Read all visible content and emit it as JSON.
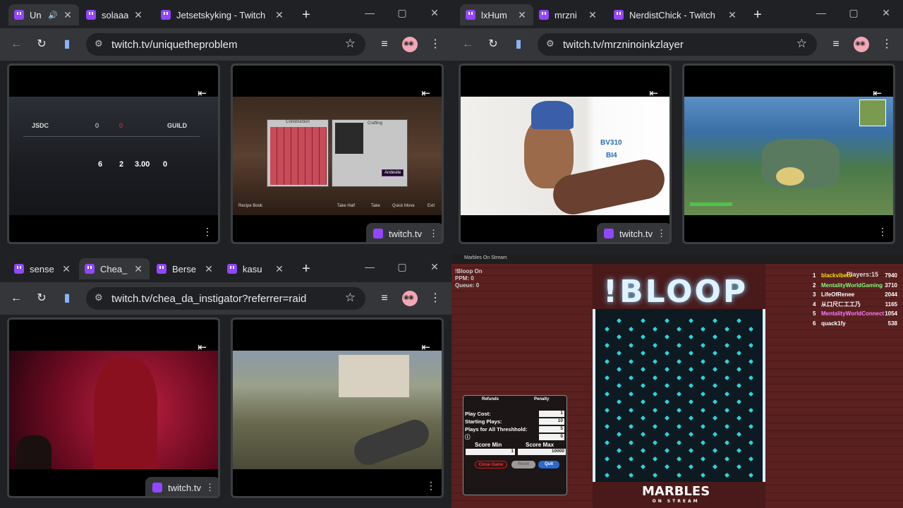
{
  "windows": [
    {
      "tabs": [
        {
          "title": "Un",
          "audio": true,
          "active": true
        },
        {
          "title": "solaaa",
          "active": false
        },
        {
          "title": "Jetsetskyking - Twitch",
          "active": false
        }
      ],
      "url": "twitch.tv/uniquetheproblem",
      "chip_label": "twitch.tv",
      "game1": {
        "team_left": "JSDC",
        "team_right": "GUILD",
        "score_left": "0",
        "score_right": "0",
        "stats": [
          "6",
          "2",
          "3.00",
          "0"
        ]
      },
      "game2": {
        "panel_left": "Construction",
        "panel_right": "Crafting",
        "tooltip": "Andesite",
        "bottom": [
          "Recipe Book",
          "Take Half",
          "Take",
          "Quick Move",
          "Exit"
        ],
        "counter": "88"
      }
    },
    {
      "tabs": [
        {
          "title": "lxHum",
          "active": true
        },
        {
          "title": "mrzni",
          "active": false
        },
        {
          "title": "NerdistChick - Twitch",
          "active": false
        }
      ],
      "url": "twitch.tv/mrzninoinkzlayer",
      "chip_label": "twitch.tv",
      "art_labels": [
        "BV310",
        "BI4"
      ]
    },
    {
      "tabs": [
        {
          "title": "sense",
          "active": false
        },
        {
          "title": "Chea_",
          "active": true
        },
        {
          "title": "Berse",
          "active": false
        },
        {
          "title": "kasu",
          "active": false
        }
      ],
      "url": "twitch.tv/chea_da_instigator?referrer=raid",
      "chip_label": "twitch.tv"
    }
  ],
  "marbles": {
    "window_title": "Marbles On Stream",
    "game_title": "!BLOOP",
    "stats": {
      "line1": "!Bloop On",
      "ppm_label": "PPM:",
      "ppm": "0",
      "queue_label": "Queue:",
      "queue": "0"
    },
    "players_label": "Players:15",
    "leaderboard": [
      {
        "rank": "1",
        "name": "blackvibetv",
        "score": "7940",
        "color": "#f5e600"
      },
      {
        "rank": "2",
        "name": "MentalityWorldGaming",
        "score": "3710",
        "color": "#7cff7c"
      },
      {
        "rank": "3",
        "name": "LifeOfRenee",
        "score": "2044",
        "color": "#ffffff"
      },
      {
        "rank": "4",
        "name": "从口尺ㄈ工工乃",
        "score": "1165",
        "color": "#ffffff"
      },
      {
        "rank": "5",
        "name": "MentalityWorldConnect",
        "score": "1054",
        "color": "#ff7cff"
      },
      {
        "rank": "6",
        "name": "quack1fy",
        "score": "538",
        "color": "#ffffff"
      }
    ],
    "panel": {
      "refunds": "Refunds",
      "penalty": "Penalty",
      "play_cost_label": "Play Cost:",
      "play_cost": "1",
      "starting_plays_label": "Starting Plays:",
      "starting_plays": "10",
      "threshold_label": "Plays for All Threshhold:",
      "threshold": "5",
      "extra_value": "0",
      "score_min_label": "Score Min",
      "score_min": "1",
      "score_max_label": "Score Max",
      "score_max": "10000",
      "close_game": "Close Game",
      "reset": "Reset",
      "quit": "Quit"
    },
    "logo": "MARBLES",
    "logo_sub": "ON STREAM"
  }
}
